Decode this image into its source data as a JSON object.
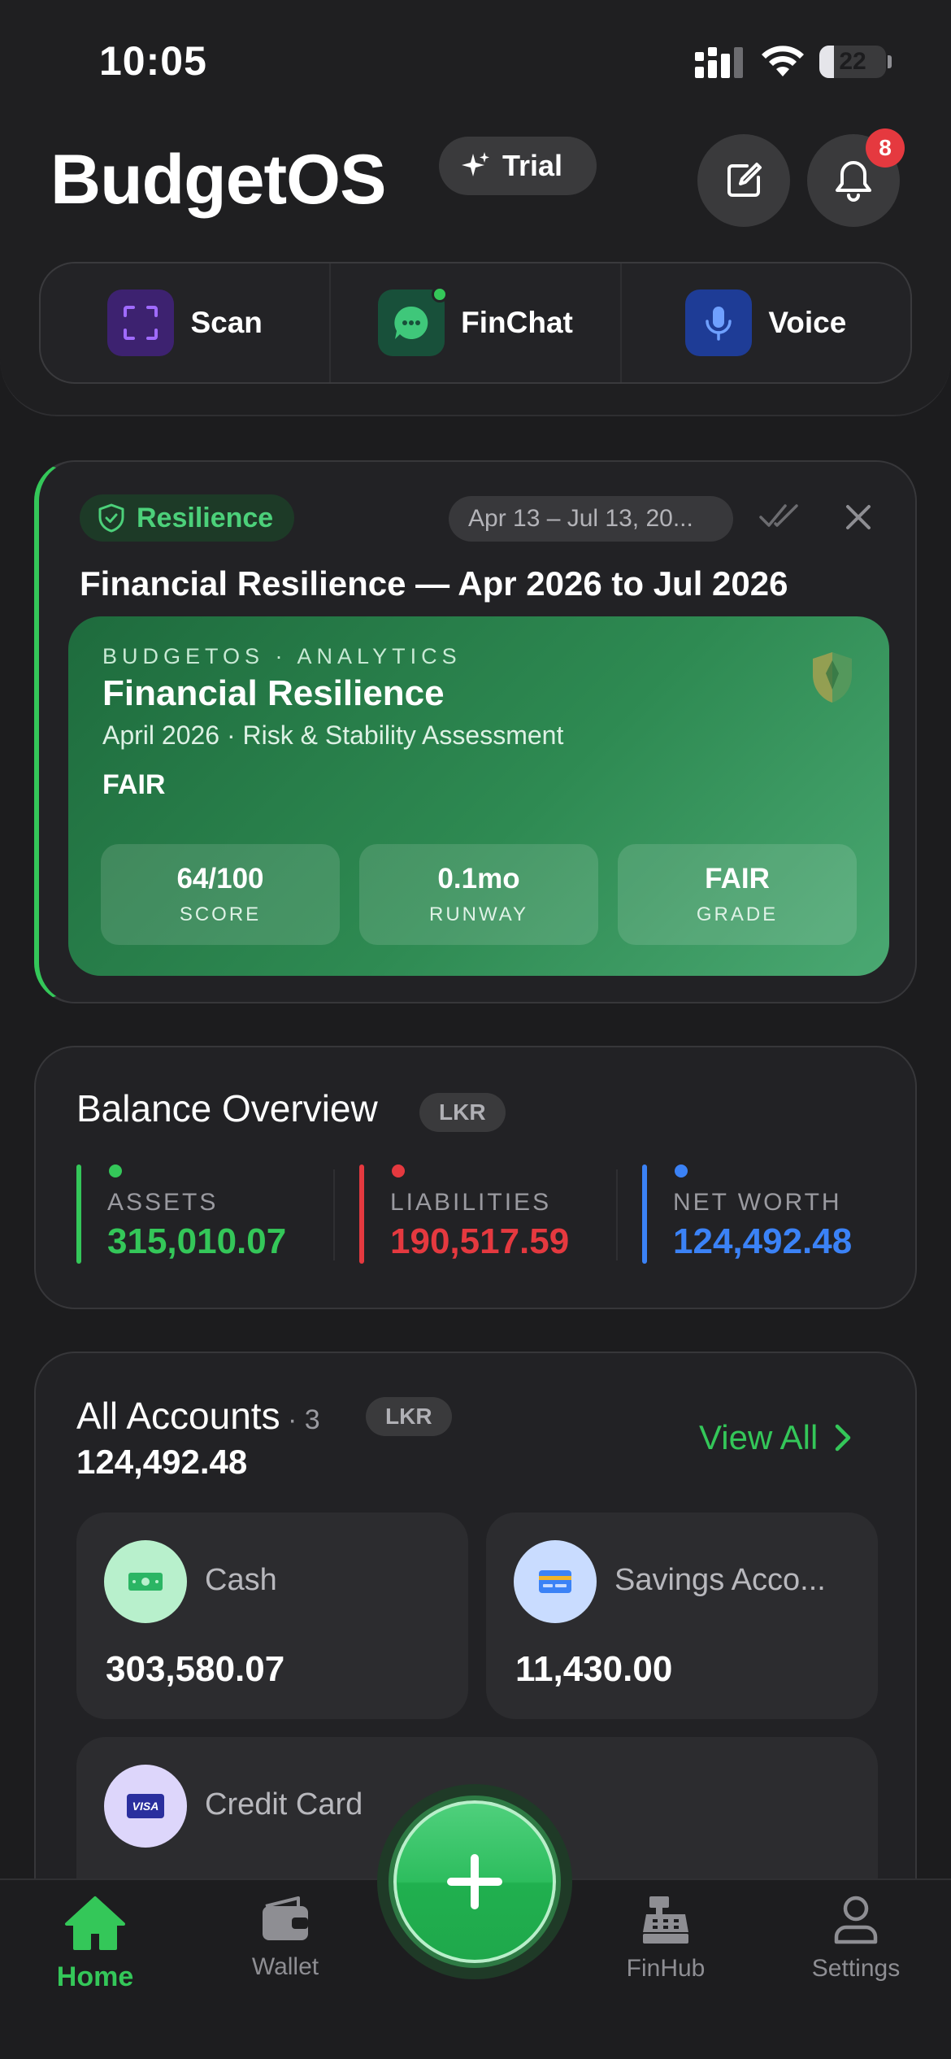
{
  "status_bar": {
    "time": "10:05",
    "battery": "22",
    "battery_level": 0.22
  },
  "header": {
    "brand": "BudgetOS",
    "trial_label": "Trial",
    "notification_count": "8"
  },
  "quick_actions": [
    {
      "label": "Scan",
      "icon": "scan-icon",
      "color": "#4b2a8c"
    },
    {
      "label": "FinChat",
      "icon": "chat-bubble-icon",
      "color": "#1f5a3c"
    },
    {
      "label": "Voice",
      "icon": "microphone-icon",
      "color": "#2345a0"
    }
  ],
  "resilience": {
    "tag": "Resilience",
    "date_range": "Apr 13 – Jul 13, 20...",
    "title": "Financial Resilience — Apr 2026 to Jul 2026",
    "kicker": "BUDGETOS · ANALYTICS",
    "inner_title": "Financial Resilience",
    "subtitle": "April 2026 · Risk & Stability Assessment",
    "grade": "FAIR",
    "stats": [
      {
        "value": "64/100",
        "label": "SCORE"
      },
      {
        "value": "0.1mo",
        "label": "RUNWAY"
      },
      {
        "value": "FAIR",
        "label": "GRADE"
      }
    ]
  },
  "balance": {
    "title": "Balance Overview",
    "currency": "LKR",
    "items": [
      {
        "label": "ASSETS",
        "value": "315,010.07",
        "color": "#34c759"
      },
      {
        "label": "LIABILITIES",
        "value": "190,517.59",
        "color": "#e5393f"
      },
      {
        "label": "NET WORTH",
        "value": "124,492.48",
        "color": "#3b82f6"
      }
    ]
  },
  "accounts": {
    "title": "All Accounts",
    "count": " · 3",
    "currency": "LKR",
    "total": "124,492.48",
    "view_all": "View All",
    "items": [
      {
        "name": "Cash",
        "value": "303,580.07",
        "icon": "cash-icon"
      },
      {
        "name": "Savings Acco...",
        "value": "11,430.00",
        "icon": "bank-card-icon"
      },
      {
        "name": "Credit Card",
        "value": "",
        "icon": "visa-card-icon",
        "brand_text": "VISA"
      }
    ]
  },
  "tabbar": {
    "tabs": [
      {
        "label": "Home",
        "icon": "home-icon",
        "active": true
      },
      {
        "label": "Wallet",
        "icon": "wallet-icon",
        "active": false
      },
      {
        "label": "FinHub",
        "icon": "cash-register-icon",
        "active": false
      },
      {
        "label": "Settings",
        "icon": "person-icon",
        "active": false
      }
    ]
  },
  "colors": {
    "accent": "#34c759",
    "danger": "#e5393f",
    "info": "#3b82f6",
    "background": "#1c1c1e"
  }
}
